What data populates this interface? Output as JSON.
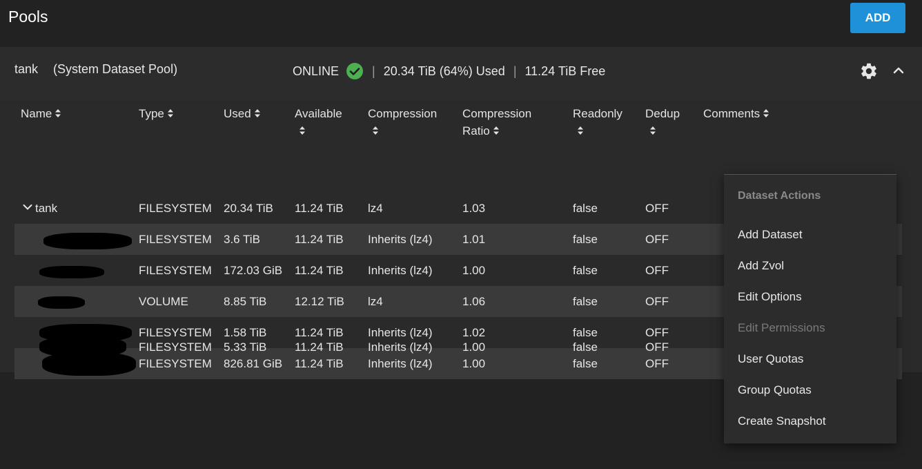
{
  "page": {
    "title": "Pools",
    "add_label": "ADD"
  },
  "pool": {
    "name": "tank",
    "subtitle": "(System Dataset Pool)",
    "status": "ONLINE",
    "used": "20.34 TiB (64%) Used",
    "free": "11.24 TiB Free",
    "status_color": "#4caf50"
  },
  "table": {
    "headers": {
      "name": "Name",
      "type": "Type",
      "used": "Used",
      "available": "Available",
      "compression": "Compression",
      "compression_ratio_1": "Compression",
      "compression_ratio_2": "Ratio",
      "readonly": "Readonly",
      "dedup": "Dedup",
      "comments": "Comments"
    },
    "rows": [
      {
        "name": "tank",
        "type": "FILESYSTEM",
        "used": "20.34 TiB",
        "available": "11.24 TiB",
        "compression": "lz4",
        "ratio": "1.03",
        "readonly": "false",
        "dedup": "OFF"
      },
      {
        "name": "",
        "type": "FILESYSTEM",
        "used": "3.6 TiB",
        "available": "11.24 TiB",
        "compression": "Inherits (lz4)",
        "ratio": "1.01",
        "readonly": "false",
        "dedup": "OFF"
      },
      {
        "name": "",
        "type": "FILESYSTEM",
        "used": "172.03 GiB",
        "available": "11.24 TiB",
        "compression": "Inherits (lz4)",
        "ratio": "1.00",
        "readonly": "false",
        "dedup": "OFF"
      },
      {
        "name": "",
        "type": "VOLUME",
        "used": "8.85 TiB",
        "available": "12.12 TiB",
        "compression": "lz4",
        "ratio": "1.06",
        "readonly": "false",
        "dedup": "OFF"
      },
      {
        "name": "",
        "type": "FILESYSTEM",
        "used": "1.58 TiB",
        "available": "11.24 TiB",
        "compression": "Inherits (lz4)",
        "ratio": "1.02",
        "readonly": "false",
        "dedup": "OFF"
      },
      {
        "name": "",
        "type": "FILESYSTEM",
        "used": "826.81 GiB",
        "available": "11.24 TiB",
        "compression": "Inherits (lz4)",
        "ratio": "1.00",
        "readonly": "false",
        "dedup": "OFF"
      },
      {
        "name": "",
        "type": "FILESYSTEM",
        "used": "5.33 TiB",
        "available": "11.24 TiB",
        "compression": "Inherits (lz4)",
        "ratio": "1.00",
        "readonly": "false",
        "dedup": "OFF"
      }
    ]
  },
  "menu": {
    "title": "Dataset Actions",
    "items": [
      {
        "label": "Add Dataset",
        "disabled": false
      },
      {
        "label": "Add Zvol",
        "disabled": false
      },
      {
        "label": "Edit Options",
        "disabled": false
      },
      {
        "label": "Edit Permissions",
        "disabled": true
      },
      {
        "label": "User Quotas",
        "disabled": false
      },
      {
        "label": "Group Quotas",
        "disabled": false
      },
      {
        "label": "Create Snapshot",
        "disabled": false
      }
    ]
  },
  "colors": {
    "accent": "#1f91d8",
    "background": "#222222",
    "row_alt": "#3a3a3a"
  }
}
